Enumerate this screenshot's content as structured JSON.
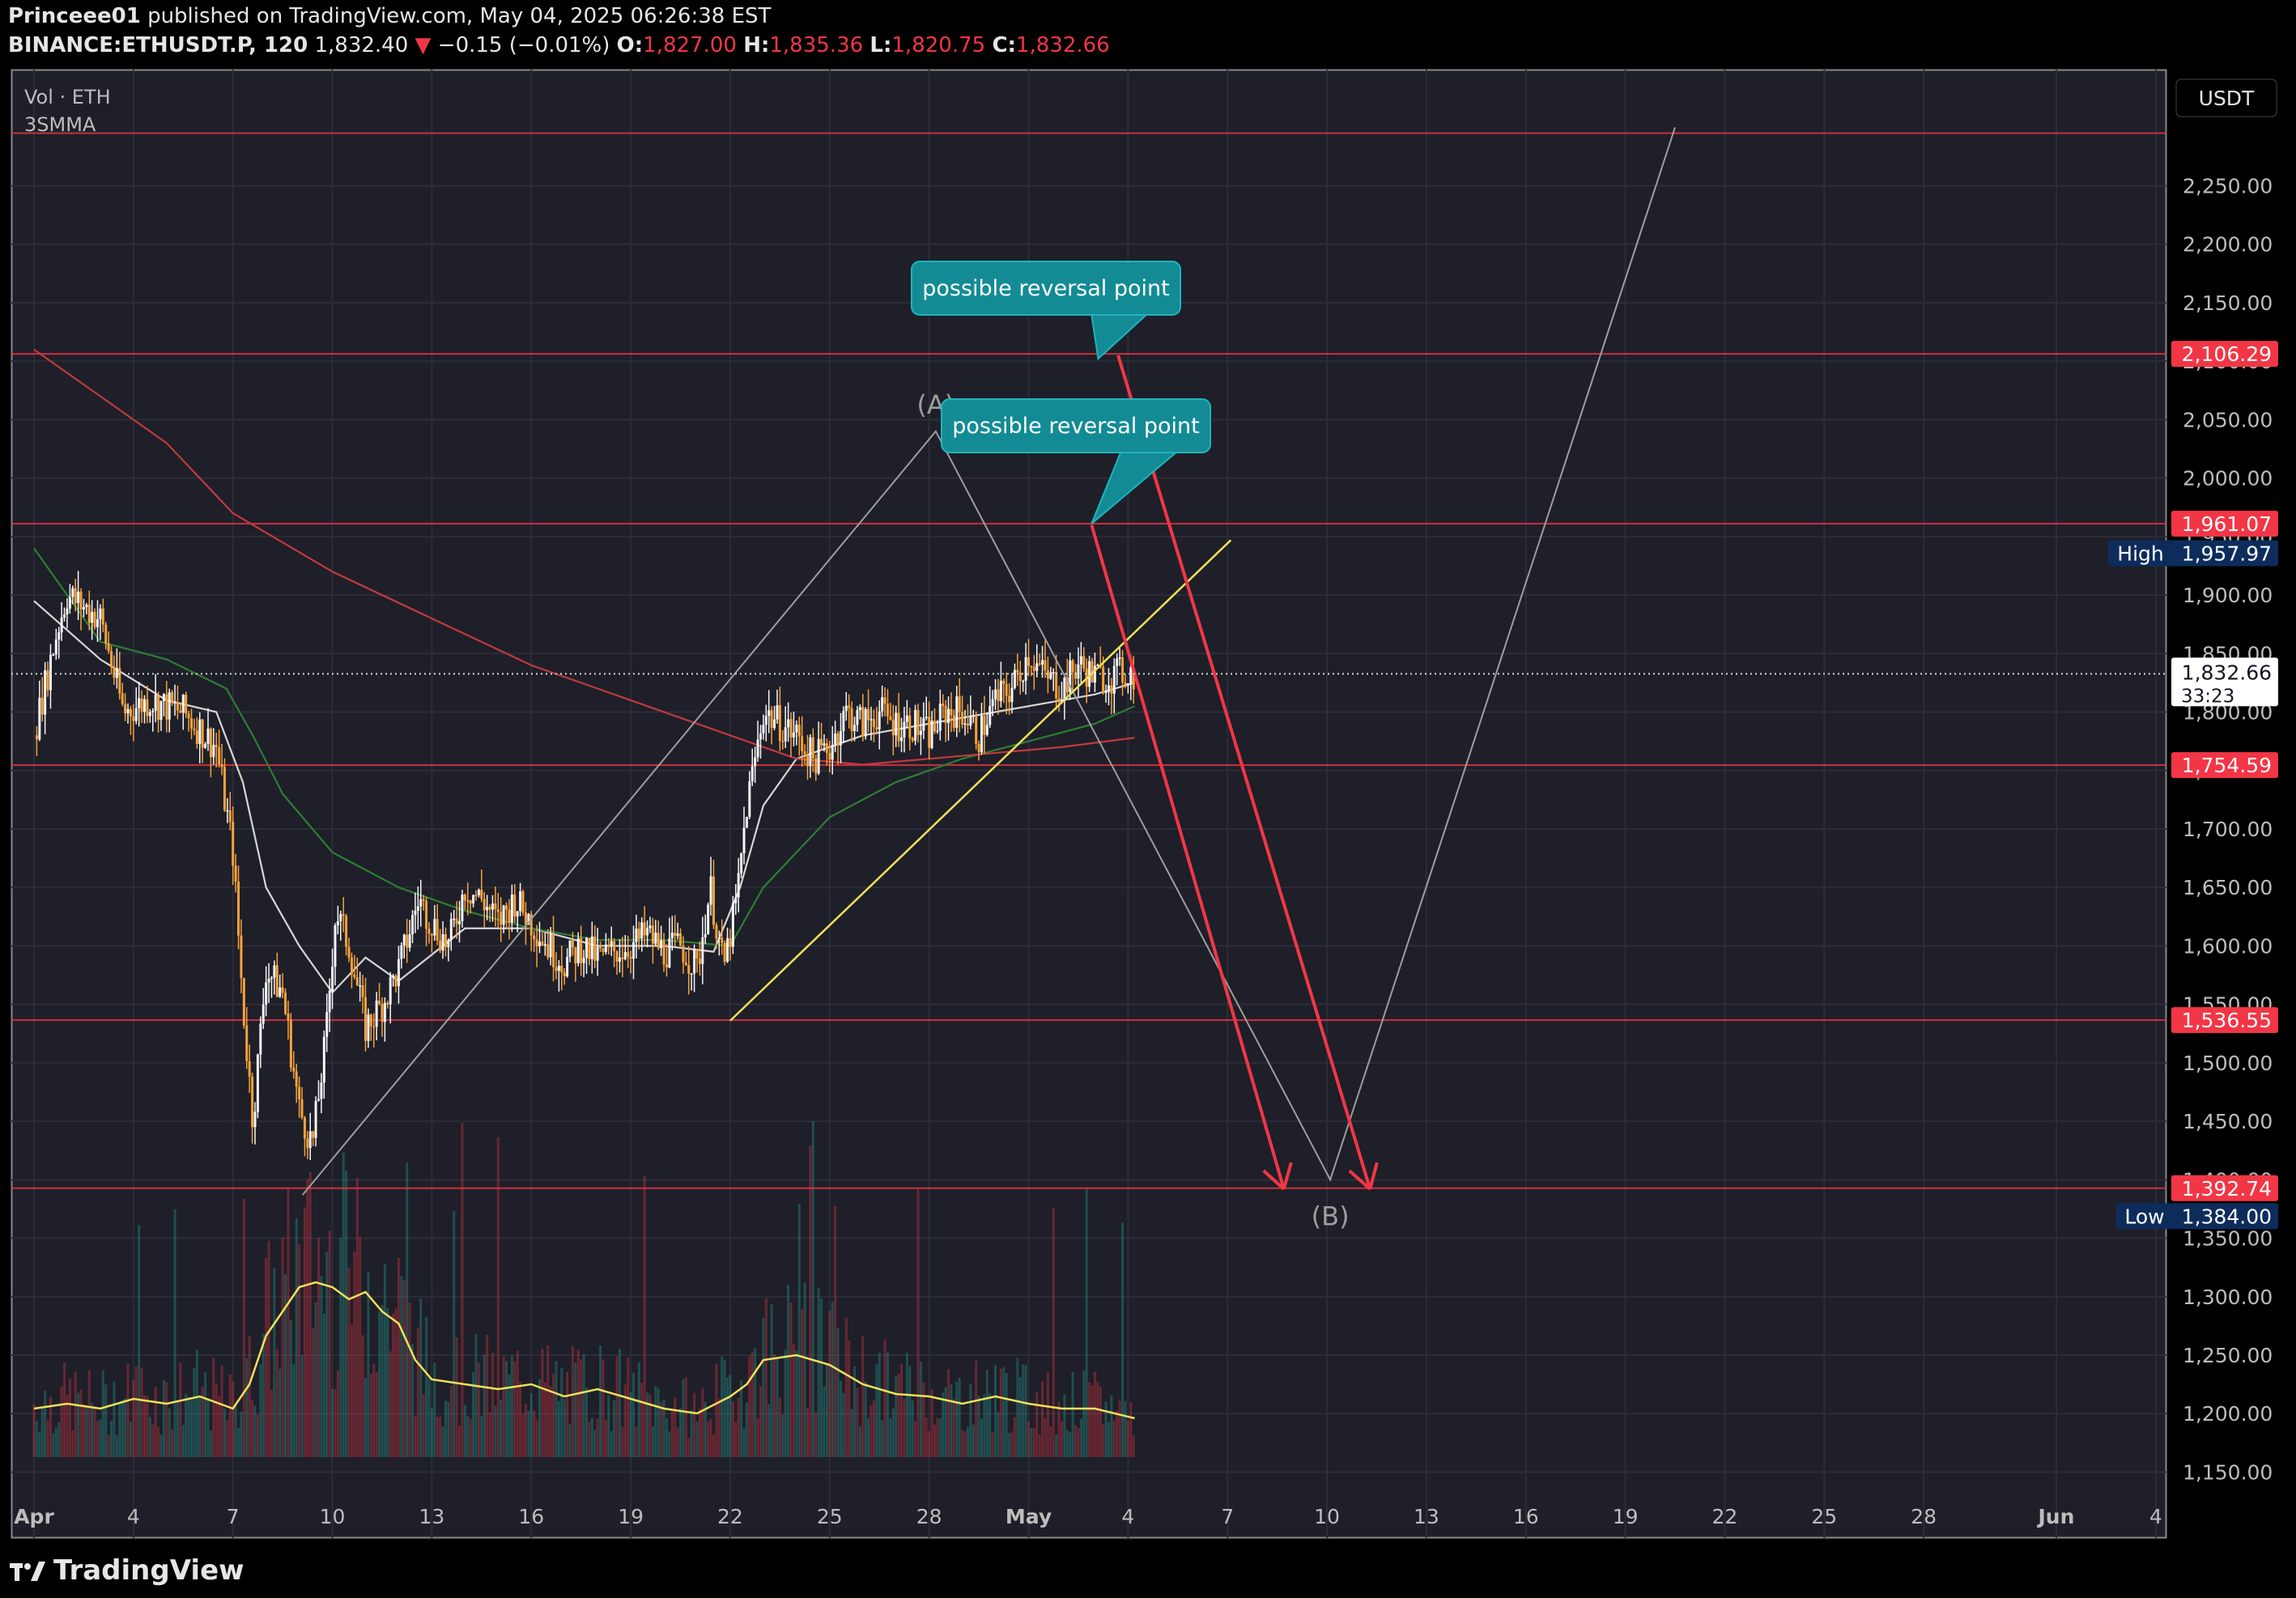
{
  "header": {
    "author": "Princeee01",
    "published": "published on TradingView.com, May 04, 2025 06:26:38 EST",
    "symbol": "BINANCE:ETHUSDT.P, 120",
    "last": "1,832.40",
    "change_arrow": "▼",
    "change": "−0.15 (−0.01%)",
    "o_label": "O:",
    "o": "1,827.00",
    "h_label": "H:",
    "h": "1,835.36",
    "l_label": "L:",
    "l": "1,820.75",
    "c_label": "C:",
    "c": "1,832.66"
  },
  "indicators": {
    "volume": "Vol · ETH",
    "ma": "3SMMA"
  },
  "currency": "USDT",
  "footer": {
    "brand": "TradingView"
  },
  "colors": {
    "background": "#1e1f29",
    "up": "#f5f5f5",
    "down": "#f7a23b",
    "level": "#f23645",
    "trend": "#f1e05a",
    "wave": "#9e9e9e",
    "callout": "#138b95"
  },
  "chart_data": {
    "type": "candlestick",
    "symbol": "BINANCE:ETHUSDT.P",
    "timeframe": "120",
    "y_ticks": [
      2250,
      2200,
      2150,
      2100,
      2050,
      2000,
      1950,
      1900,
      1850,
      1800,
      1750,
      1700,
      1650,
      1600,
      1550,
      1500,
      1450,
      1400,
      1350,
      1300,
      1250,
      1200,
      1150
    ],
    "x_ticks": [
      "Apr",
      "4",
      "7",
      "10",
      "13",
      "16",
      "19",
      "22",
      "25",
      "28",
      "May",
      "4",
      "7",
      "10",
      "13",
      "16",
      "19",
      "22",
      "25",
      "28",
      "Jun",
      "4"
    ],
    "x_tick_days": [
      1,
      4,
      7,
      10,
      13,
      16,
      19,
      22,
      25,
      28,
      31,
      34,
      37,
      40,
      43,
      46,
      49,
      52,
      55,
      58,
      62,
      65
    ],
    "price_path": [
      [
        1,
        1780
      ],
      [
        1.7,
        1870
      ],
      [
        2,
        1900
      ],
      [
        3,
        1880
      ],
      [
        3.7,
        1800
      ],
      [
        4.5,
        1810
      ],
      [
        5.5,
        1800
      ],
      [
        6.5,
        1770
      ],
      [
        7,
        1680
      ],
      [
        7.3,
        1550
      ],
      [
        7.6,
        1450
      ],
      [
        8,
        1580
      ],
      [
        8.5,
        1560
      ],
      [
        9,
        1460
      ],
      [
        9.4,
        1430
      ],
      [
        9.8,
        1520
      ],
      [
        10.1,
        1630
      ],
      [
        10.5,
        1600
      ],
      [
        11,
        1530
      ],
      [
        11.5,
        1550
      ],
      [
        12,
        1580
      ],
      [
        12.6,
        1640
      ],
      [
        13,
        1620
      ],
      [
        13.5,
        1600
      ],
      [
        14,
        1650
      ],
      [
        14.5,
        1640
      ],
      [
        15,
        1620
      ],
      [
        15.5,
        1640
      ],
      [
        16,
        1620
      ],
      [
        16.5,
        1600
      ],
      [
        17,
        1585
      ],
      [
        17.5,
        1600
      ],
      [
        18,
        1590
      ],
      [
        18.5,
        1595
      ],
      [
        19,
        1600
      ],
      [
        19.5,
        1610
      ],
      [
        20,
        1595
      ],
      [
        20.5,
        1600
      ],
      [
        21,
        1580
      ],
      [
        21.4,
        1650
      ],
      [
        21.8,
        1580
      ],
      [
        22.2,
        1640
      ],
      [
        22.5,
        1720
      ],
      [
        23,
        1800
      ],
      [
        23.5,
        1790
      ],
      [
        24,
        1780
      ],
      [
        24.5,
        1760
      ],
      [
        25,
        1770
      ],
      [
        25.5,
        1800
      ],
      [
        26,
        1790
      ],
      [
        26.5,
        1800
      ],
      [
        27,
        1790
      ],
      [
        27.5,
        1790
      ],
      [
        28,
        1780
      ],
      [
        28.5,
        1800
      ],
      [
        29,
        1800
      ],
      [
        29.5,
        1780
      ],
      [
        30,
        1810
      ],
      [
        30.5,
        1820
      ],
      [
        31,
        1850
      ],
      [
        31.5,
        1830
      ],
      [
        32,
        1820
      ],
      [
        32.5,
        1840
      ],
      [
        33,
        1830
      ],
      [
        33.5,
        1830
      ],
      [
        34,
        1835
      ],
      [
        34.2,
        1832
      ]
    ],
    "last_price": 1832.66,
    "countdown": "33:23",
    "levels": [
      2295,
      2106.29,
      1961.07,
      1754.59,
      1536.55,
      1392.74
    ],
    "level_labels": [
      "2,106.29",
      "1,961.07",
      "1,754.59",
      "1,536.55",
      "1,392.74"
    ],
    "high": {
      "label": "High",
      "value": "1,957.97"
    },
    "low": {
      "label": "Low",
      "value": "1,384.00"
    },
    "current_label": "1,832.66",
    "annotations": [
      {
        "text": "possible reversal point",
        "target": 2106.29
      },
      {
        "text": "possible reversal point",
        "target": 1961.07
      }
    ],
    "wave_labels": [
      "(A)",
      "(B)"
    ],
    "wave_points": [
      [
        9.1,
        1387
      ],
      [
        28.2,
        2040
      ],
      [
        40.1,
        1400
      ],
      [
        50.5,
        2300
      ]
    ],
    "projections": [
      {
        "from": [
          32.9,
          1960
        ],
        "to": [
          38.7,
          1392
        ]
      },
      {
        "from": [
          33.7,
          2105
        ],
        "to": [
          41.3,
          1392
        ]
      }
    ],
    "trendline": {
      "from": [
        22,
        1536
      ],
      "to": [
        37.1,
        1947
      ]
    },
    "ma_series": [
      {
        "name": "",
        "color": "#d6d6d6",
        "points": [
          [
            1,
            1895
          ],
          [
            3,
            1845
          ],
          [
            5,
            1810
          ],
          [
            6.5,
            1800
          ],
          [
            7.3,
            1740
          ],
          [
            8,
            1650
          ],
          [
            9,
            1600
          ],
          [
            10,
            1560
          ],
          [
            11,
            1590
          ],
          [
            12,
            1570
          ],
          [
            14,
            1615
          ],
          [
            16,
            1615
          ],
          [
            18,
            1600
          ],
          [
            20,
            1600
          ],
          [
            21.5,
            1595
          ],
          [
            22.3,
            1650
          ],
          [
            23,
            1720
          ],
          [
            24,
            1760
          ],
          [
            26,
            1780
          ],
          [
            28,
            1790
          ],
          [
            30,
            1800
          ],
          [
            32,
            1810
          ],
          [
            33,
            1815
          ],
          [
            34.2,
            1825
          ]
        ]
      },
      {
        "name": "",
        "color": "#2e7d32",
        "points": [
          [
            1,
            1940
          ],
          [
            3,
            1860
          ],
          [
            5,
            1845
          ],
          [
            6.8,
            1820
          ],
          [
            7.6,
            1780
          ],
          [
            8.5,
            1730
          ],
          [
            10,
            1680
          ],
          [
            12,
            1650
          ],
          [
            14,
            1630
          ],
          [
            16,
            1615
          ],
          [
            18,
            1605
          ],
          [
            20,
            1605
          ],
          [
            22,
            1600
          ],
          [
            23,
            1650
          ],
          [
            25,
            1710
          ],
          [
            27,
            1740
          ],
          [
            29,
            1760
          ],
          [
            31,
            1775
          ],
          [
            33,
            1790
          ],
          [
            34.2,
            1805
          ]
        ]
      },
      {
        "name": "",
        "color": "#c2393f",
        "points": [
          [
            1,
            2110
          ],
          [
            3,
            2070
          ],
          [
            5,
            2030
          ],
          [
            7,
            1970
          ],
          [
            10,
            1920
          ],
          [
            13,
            1880
          ],
          [
            16,
            1840
          ],
          [
            19,
            1810
          ],
          [
            22,
            1780
          ],
          [
            24,
            1760
          ],
          [
            26,
            1755
          ],
          [
            28,
            1760
          ],
          [
            30,
            1765
          ],
          [
            32,
            1770
          ],
          [
            34.2,
            1778
          ]
        ]
      }
    ],
    "volume_ma": [
      [
        1,
        0.2
      ],
      [
        2,
        0.22
      ],
      [
        3,
        0.2
      ],
      [
        4,
        0.24
      ],
      [
        5,
        0.22
      ],
      [
        6,
        0.25
      ],
      [
        7,
        0.2
      ],
      [
        7.5,
        0.3
      ],
      [
        8,
        0.5
      ],
      [
        8.5,
        0.6
      ],
      [
        9,
        0.7
      ],
      [
        9.5,
        0.72
      ],
      [
        10,
        0.7
      ],
      [
        10.5,
        0.65
      ],
      [
        11,
        0.68
      ],
      [
        11.5,
        0.6
      ],
      [
        12,
        0.55
      ],
      [
        12.5,
        0.4
      ],
      [
        13,
        0.32
      ],
      [
        14,
        0.3
      ],
      [
        15,
        0.28
      ],
      [
        16,
        0.3
      ],
      [
        17,
        0.25
      ],
      [
        18,
        0.28
      ],
      [
        19,
        0.24
      ],
      [
        20,
        0.2
      ],
      [
        21,
        0.18
      ],
      [
        22,
        0.25
      ],
      [
        22.5,
        0.3
      ],
      [
        23,
        0.4
      ],
      [
        24,
        0.42
      ],
      [
        25,
        0.38
      ],
      [
        26,
        0.3
      ],
      [
        27,
        0.26
      ],
      [
        28,
        0.25
      ],
      [
        29,
        0.22
      ],
      [
        30,
        0.25
      ],
      [
        31,
        0.22
      ],
      [
        32,
        0.2
      ],
      [
        33,
        0.2
      ],
      [
        34.2,
        0.16
      ]
    ]
  }
}
